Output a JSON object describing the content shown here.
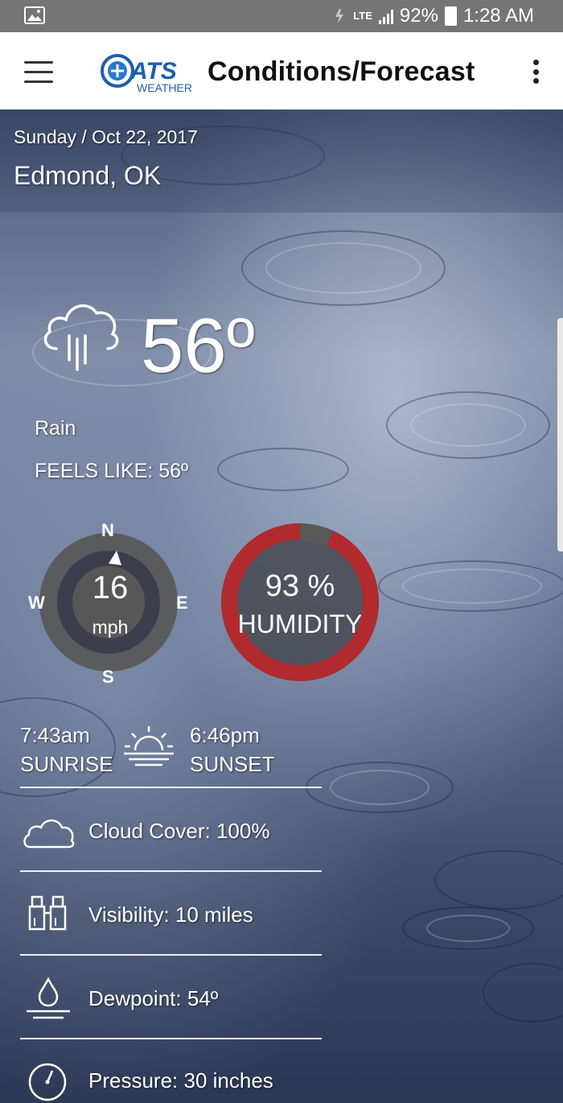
{
  "status_bar": {
    "battery": "92%",
    "time": "1:28 AM",
    "network": "LTE"
  },
  "app_bar": {
    "title": "Conditions/Forecast",
    "logo_text": "ATS",
    "logo_subtext": "WEATHER"
  },
  "location": {
    "date": "Sunday / Oct 22, 2017",
    "city": "Edmond, OK"
  },
  "current": {
    "temperature": "56º",
    "condition": "Rain",
    "feels_like": "FEELS LIKE: 56º",
    "icon": "cloud-rain-icon"
  },
  "wind": {
    "speed": "16",
    "unit": "mph",
    "directions": {
      "n": "N",
      "e": "E",
      "s": "S",
      "w": "W"
    }
  },
  "humidity": {
    "value": "93 %",
    "label": "HUMIDITY",
    "fraction": 0.93
  },
  "sun": {
    "sunrise_time": "7:43am",
    "sunrise_label": "SUNRISE",
    "sunset_time": "6:46pm",
    "sunset_label": "SUNSET"
  },
  "details": {
    "cloud_cover": "Cloud Cover: 100%",
    "visibility": "Visibility: 10 miles",
    "dewpoint": "Dewpoint: 54º",
    "pressure": "Pressure: 30 inches"
  },
  "colors": {
    "humidity_ring": "#b02a2e",
    "ring_gray": "#585858",
    "status_bar": "#757575"
  }
}
